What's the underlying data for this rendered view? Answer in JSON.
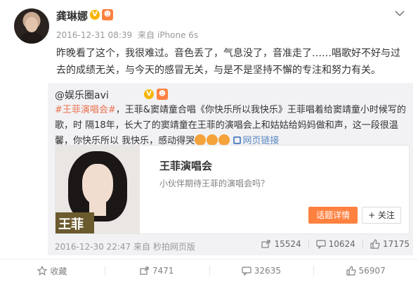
{
  "post": {
    "author": "龚琳娜",
    "vip_badge": "V",
    "level_badge": "☻",
    "timestamp": "2016-12-31 08:39",
    "source_prefix": "来自",
    "source": "iPhone 6s",
    "text_line1": "昨晚看了这个，我很难过。音色丢了，气息没了，音准走了……唱歌好不好与过",
    "text_line2": "去的成绩无关，与今天的感冒无关，与是不是坚持不懈的专注和努力有关。"
  },
  "repost": {
    "author": "@娱乐圈avi",
    "vip_badge": "V",
    "level_badge": "☻",
    "topic": "#王菲演唱会#",
    "text_a": "，王菲&窦靖童合唱《你快乐所以我快乐》王菲唱着给窦靖童小时候写的歌，时",
    "text_b": "隔18年，长大了的窦靖童在王菲的演唱会上和姑姑给妈妈做和声，这一段很温馨，你快乐所以",
    "text_c": "我快乐，感动得哭",
    "link_label": "网页链接",
    "card": {
      "image_label": "王菲",
      "title": "王菲演唱会",
      "subtitle": "小伙伴期待王菲的演唱会吗？",
      "detail_button": "话题详情",
      "follow_button": "+ 关注"
    },
    "footer": {
      "date": "2016-12-30 22:47",
      "source_prefix": "来自",
      "source": "秒拍网页版",
      "reposts": "15524",
      "comments": "10624",
      "likes": "17175"
    }
  },
  "actions": {
    "favorite": "收藏",
    "reposts": "7471",
    "comments": "32635",
    "likes": "56907"
  },
  "colors": {
    "accent": "#ff8140",
    "link": "#5b89c2",
    "topic": "#eb7350",
    "vip": "#f7b500"
  }
}
